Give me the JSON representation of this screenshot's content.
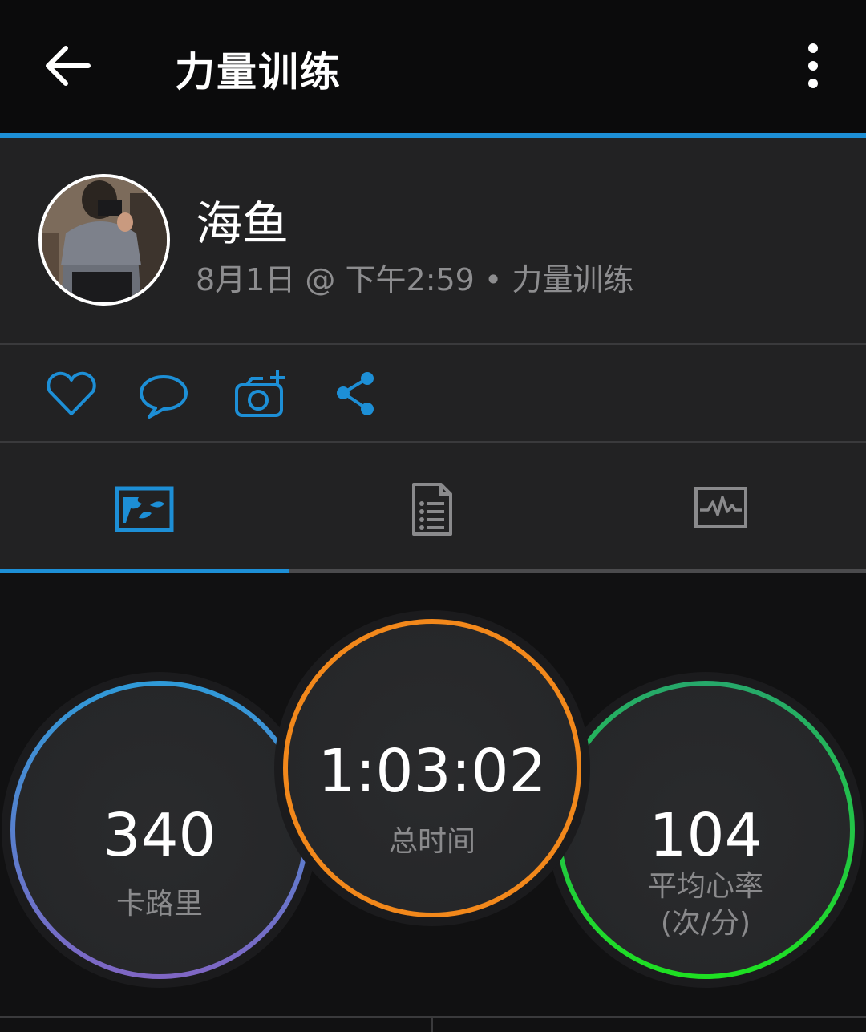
{
  "appbar": {
    "title": "力量训练",
    "back_icon": "arrow-left-icon",
    "more_icon": "more-vertical-icon"
  },
  "profile": {
    "name": "海鱼",
    "meta": "8月1日 @ 下午2:59 • 力量训练"
  },
  "actions": {
    "icons": [
      "heart-icon",
      "comment-icon",
      "add-photo-icon",
      "share-icon"
    ],
    "accent": "#1d8fd6"
  },
  "tabs": {
    "items": [
      "overview-map-icon",
      "details-list-icon",
      "chart-activity-icon"
    ],
    "selected_index": 0
  },
  "stats": {
    "calories": {
      "value": "340",
      "label": "卡路里"
    },
    "total_time": {
      "value": "1:03:02",
      "label": "总时间"
    },
    "avg_heart_rate": {
      "value": "104",
      "label_line1": "平均心率",
      "label_line2": "(次/分)"
    }
  },
  "colors": {
    "accent_blue": "#1d8fd6",
    "time_orange": "#f2881b",
    "hr_green": "#1fd13a",
    "cal_purple": "#7a6cc9"
  }
}
